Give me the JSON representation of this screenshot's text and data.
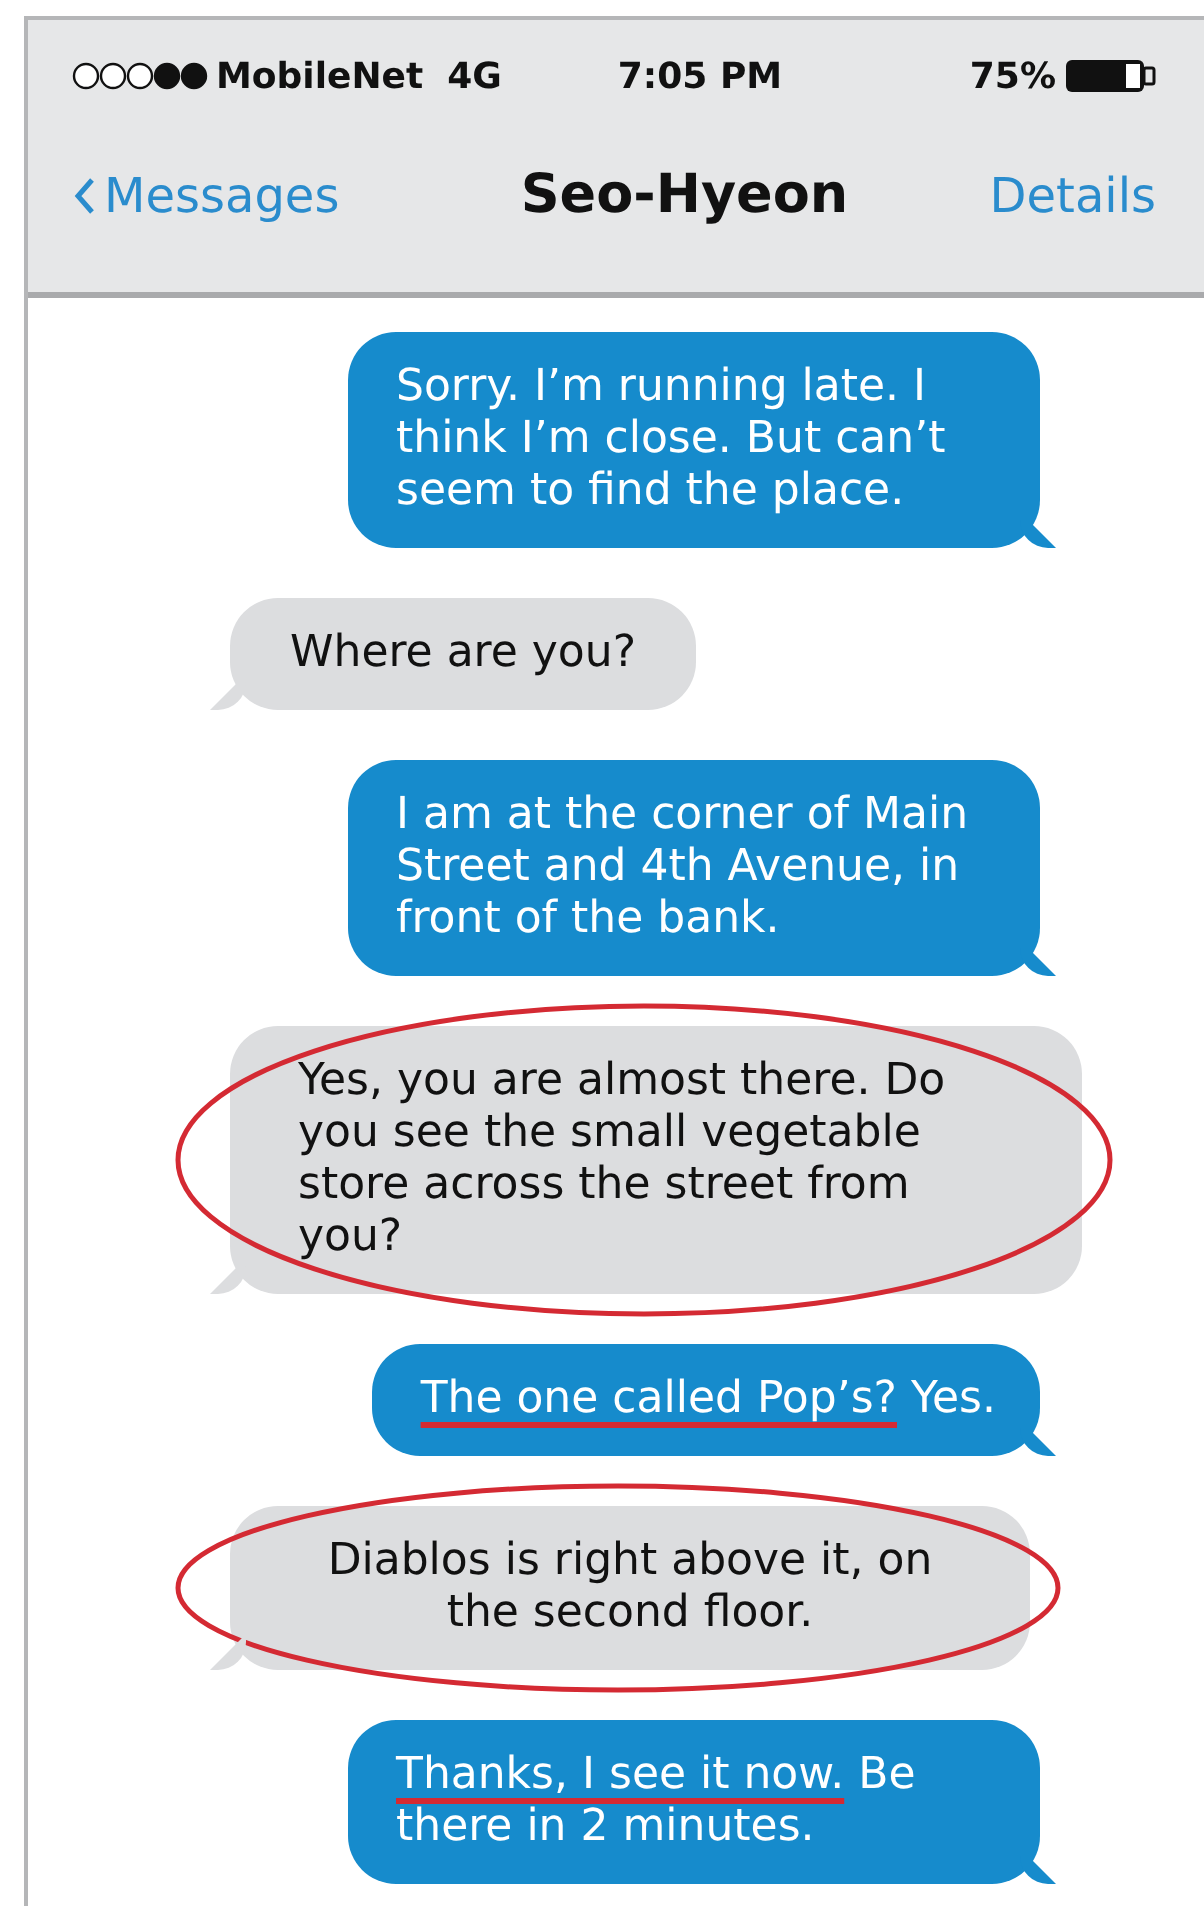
{
  "status_bar": {
    "carrier": "MobileNet",
    "network": "4G",
    "time": "7:05 PM",
    "battery": "75%"
  },
  "nav": {
    "back": "Messages",
    "title": "Seo-Hyeon",
    "action": "Details"
  },
  "messages": [
    {
      "kind": "sent",
      "text": "Sorry. I’m running late. I think I’m close. But can’t seem to find the place.",
      "circled": false
    },
    {
      "kind": "received",
      "text": "Where are you?",
      "circled": false
    },
    {
      "kind": "sent",
      "text": "I am at the corner of Main Street and 4th Avenue, in front of the bank.",
      "circled": false
    },
    {
      "kind": "received",
      "text": "Yes, you are almost there. Do you see the small vegetable store across the street from you?",
      "circled": true
    },
    {
      "kind": "sent",
      "underlined": "The one called Pop’s?",
      "text": " Yes.",
      "circled": false
    },
    {
      "kind": "received",
      "text": "Diablos is right above it, on the second floor.",
      "circled": true
    },
    {
      "kind": "sent",
      "underlined": "Thanks, I see it now.",
      "text": " Be there in 2 minutes.",
      "circled": false
    }
  ]
}
